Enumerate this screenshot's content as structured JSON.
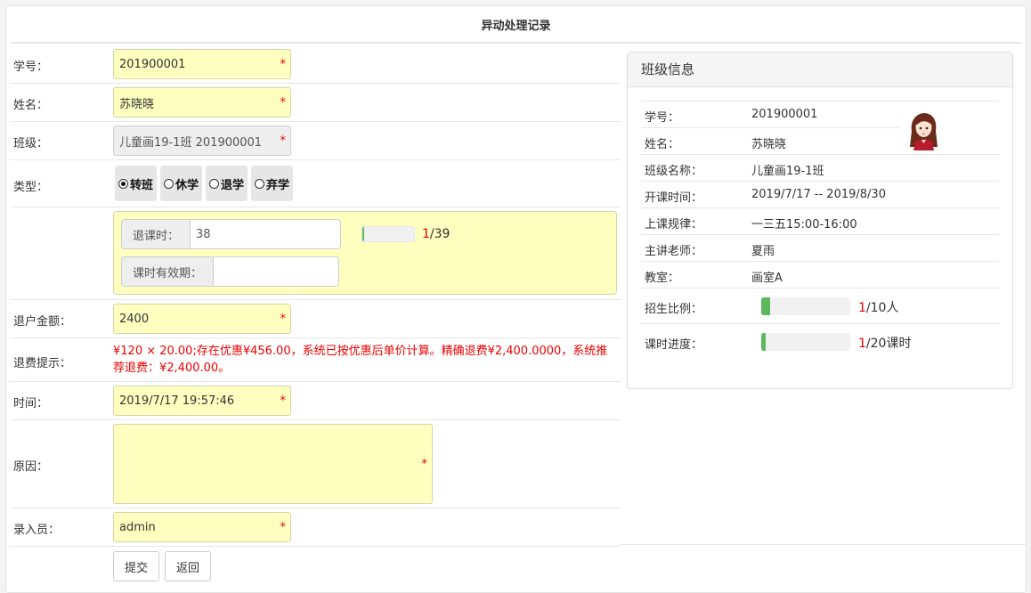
{
  "page": {
    "title": "异动处理记录"
  },
  "form": {
    "student_id": {
      "label": "学号：",
      "value": "201900001",
      "required": "*"
    },
    "name": {
      "label": "姓名：",
      "value": "苏晓晓",
      "required": "*"
    },
    "class": {
      "label": "班级：",
      "value": "儿童画19-1班 201900001",
      "required": "*"
    },
    "type": {
      "label": "类型：",
      "options": [
        "转班",
        "休学",
        "退学",
        "弃学"
      ],
      "selected": "转班"
    },
    "refund_hours": {
      "label": "退课时：",
      "value": "38",
      "progress_used": 1,
      "progress_total": 39,
      "progress_suffix": "/39",
      "progress_fraction": 0.026
    },
    "validity": {
      "label": "课时有效期：",
      "value": ""
    },
    "refund_amount": {
      "label": "退户金额：",
      "value": "2400",
      "required": "*"
    },
    "refund_hint": {
      "label": "退费提示：",
      "text": "¥120 × 20.00;存在优惠¥456.00，系统已按优惠后单价计算。精确退费¥2,400.0000，系统推荐退费：¥2,400.00。"
    },
    "time": {
      "label": "时间：",
      "value": "2019/7/17 19:57:46",
      "required": "*"
    },
    "reason": {
      "label": "原因：",
      "value": "",
      "required": "*"
    },
    "operator": {
      "label": "录入员：",
      "value": "admin",
      "required": "*"
    },
    "submit_label": "提交",
    "back_label": "返回"
  },
  "class_info": {
    "title": "班级信息",
    "rows": [
      {
        "key": "学号：",
        "value": "201900001"
      },
      {
        "key": "姓名：",
        "value": "苏晓晓"
      },
      {
        "key": "班级名称：",
        "value": "儿童画19-1班"
      },
      {
        "key": "开课时间：",
        "value": "2019/7/17 -- 2019/8/30"
      },
      {
        "key": "上课规律：",
        "value": "一三五15:00-16:00"
      },
      {
        "key": "主讲老师：",
        "value": "夏雨"
      },
      {
        "key": "教室：",
        "value": "画室A"
      }
    ],
    "enrollment": {
      "key": "招生比例：",
      "current": "1",
      "suffix": "/10人",
      "fraction": 0.1
    },
    "progress": {
      "key": "课时进度：",
      "current": "1",
      "suffix": "/20课时",
      "fraction": 0.05
    }
  },
  "colors": {
    "field_bg": "#ffffc0",
    "required": "#ee0000",
    "progress": "#5cb85c"
  }
}
